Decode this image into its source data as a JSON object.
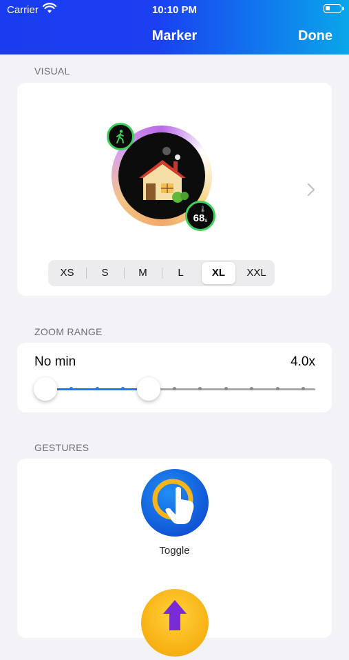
{
  "status_bar": {
    "carrier": "Carrier",
    "time": "10:10 PM"
  },
  "nav": {
    "title": "Marker",
    "done": "Done"
  },
  "visual": {
    "header": "VISUAL",
    "temperature": "68",
    "temperature_unit": "s",
    "sizes": [
      "XS",
      "S",
      "M",
      "L",
      "XL",
      "XXL"
    ],
    "selected_size": "XL"
  },
  "zoom": {
    "header": "ZOOM RANGE",
    "min_label": "No min",
    "max_label": "4.0x",
    "tick_count": 11,
    "min_index": 0,
    "max_index": 4
  },
  "gestures": {
    "header": "GESTURES",
    "items": [
      {
        "label": "Toggle",
        "icon": "toggle-tap-icon"
      },
      {
        "label": "",
        "icon": "arrow-up-icon"
      }
    ]
  },
  "colors": {
    "header_start": "#1a3cf0",
    "header_end": "#0aa6ea",
    "accent": "#1e7cf2",
    "badge_green": "#3dd15c"
  }
}
